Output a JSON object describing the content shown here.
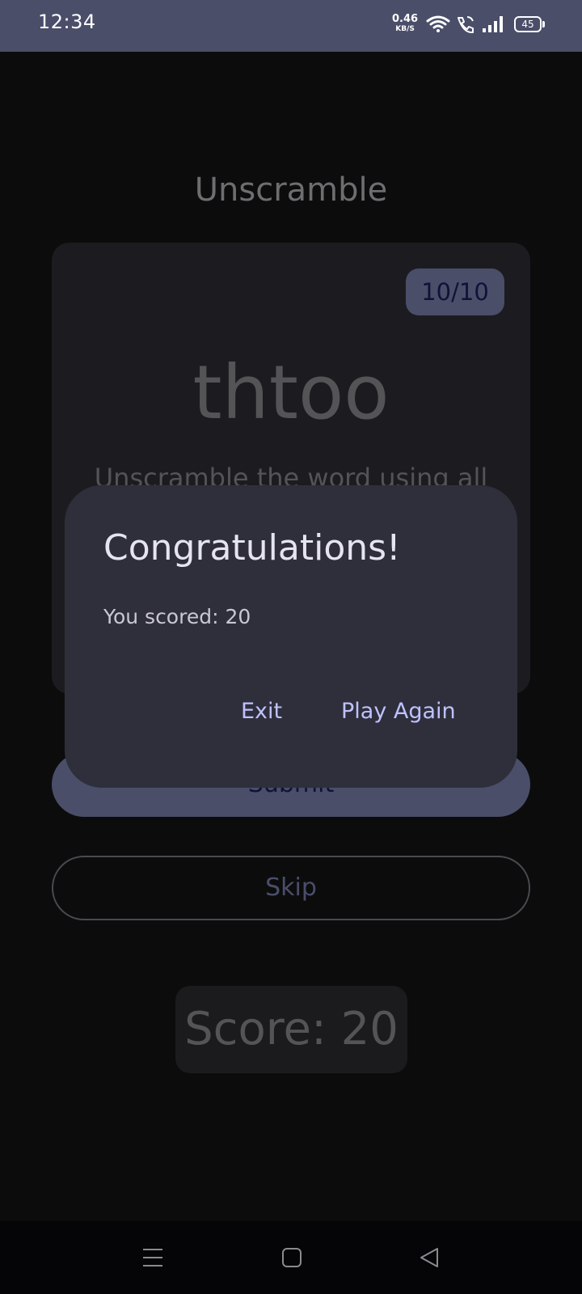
{
  "status_bar": {
    "time": "12:34",
    "net_speed": "0.46",
    "net_unit": "KB/S",
    "battery": "45",
    "icons": [
      "wifi-icon",
      "wifi-call-icon",
      "signal-icon",
      "battery-icon"
    ]
  },
  "app": {
    "title": "Unscramble",
    "counter": "10/10",
    "scrambled_word": "thtoo",
    "instructions": "Unscramble the word using all",
    "submit_label": "Submit",
    "skip_label": "Skip",
    "score_label": "Score: 20"
  },
  "dialog": {
    "title": "Congratulations!",
    "message": "You scored: 20",
    "exit_label": "Exit",
    "play_again_label": "Play Again"
  },
  "nav_bar": {
    "icons": [
      "menu-icon",
      "home-icon",
      "back-icon"
    ]
  },
  "colors": {
    "status_bar": "#4a4e69",
    "background": "#0c0c0d",
    "dialog_bg": "#2e2f3b",
    "dialog_action": "#bfc2ff",
    "primary": "#4a4e69"
  }
}
